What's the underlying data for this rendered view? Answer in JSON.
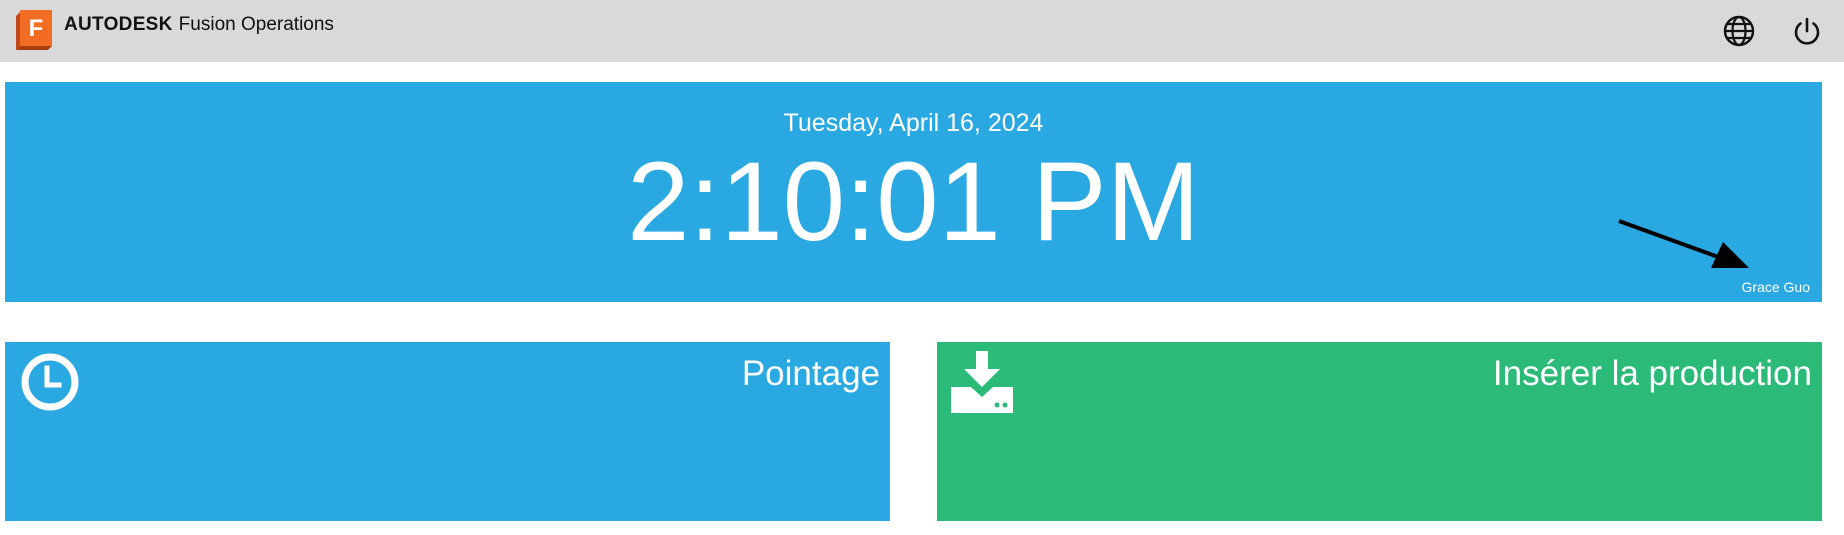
{
  "header": {
    "logo_letter": "F",
    "brand_company": "AUTODESK",
    "brand_product": "Fusion Operations",
    "icons": [
      "globe-icon",
      "power-icon"
    ]
  },
  "clock": {
    "date": "Tuesday, April 16, 2024",
    "time": "2:10:01 PM",
    "user_name": "Grace Guo"
  },
  "tiles": [
    {
      "label": "Pointage",
      "icon": "clock-icon",
      "color": "#29a8e2"
    },
    {
      "label": "Insérer la production",
      "icon": "download-icon",
      "color": "#2bba78"
    }
  ],
  "colors": {
    "header_bg": "#d9d9d9",
    "logo_orange": "#f26c23",
    "panel_blue": "#29a8e2",
    "tile_green": "#2bba78"
  }
}
